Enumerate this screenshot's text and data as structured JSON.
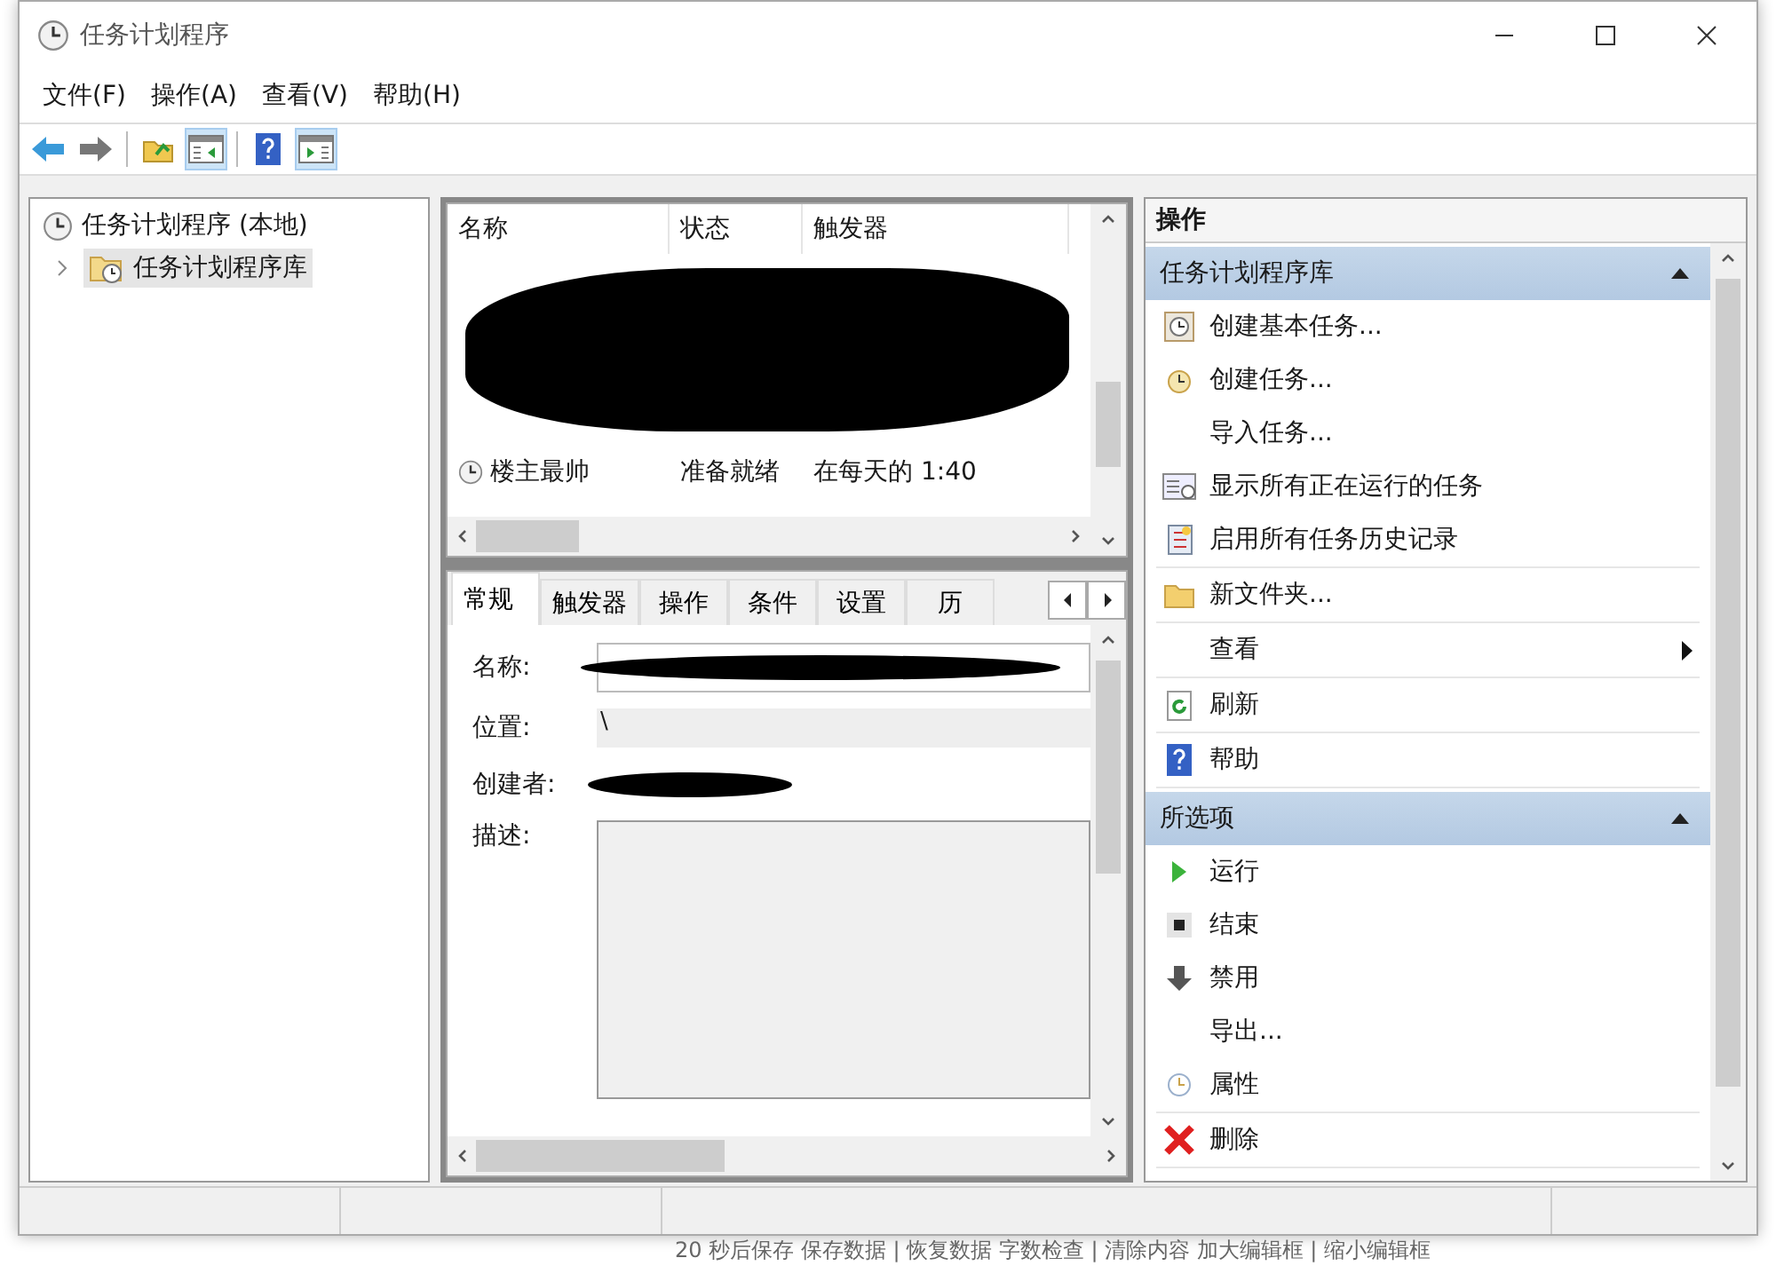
{
  "window": {
    "title": "任务计划程序"
  },
  "menu": [
    "文件(F)",
    "操作(A)",
    "查看(V)",
    "帮助(H)"
  ],
  "toolbar": [
    [
      {
        "kind": "back",
        "on": false
      },
      {
        "kind": "forward",
        "on": false
      }
    ],
    [
      {
        "kind": "folder-up",
        "on": false
      },
      {
        "kind": "tree-pane",
        "on": true
      }
    ],
    [
      {
        "kind": "help",
        "on": false
      },
      {
        "kind": "action-pane",
        "on": true
      }
    ]
  ],
  "tree": [
    {
      "label": "任务计划程序 (本地)",
      "selected": false,
      "children": [
        {
          "label": "任务计划程序库",
          "selected": true
        }
      ]
    }
  ],
  "task_list": {
    "columns": [
      "名称",
      "状态",
      "触发器"
    ],
    "rows": [
      {
        "name": "楼主最帅",
        "status": "准备就绪",
        "trigger": "在每天的 1:40"
      }
    ]
  },
  "detail_tabs": [
    {
      "label": "常规",
      "selected": true
    },
    {
      "label": "触发器",
      "selected": false
    },
    {
      "label": "操作",
      "selected": false
    },
    {
      "label": "条件",
      "selected": false
    },
    {
      "label": "设置",
      "selected": false
    },
    {
      "label": "历",
      "selected": false
    }
  ],
  "general_fields": [
    {
      "label": "名称:",
      "kind": "redacted-field"
    },
    {
      "label": "位置:",
      "kind": "readonly",
      "value": "\\"
    },
    {
      "label": "创建者:",
      "kind": "redacted"
    },
    {
      "label": "描述:",
      "kind": "textarea"
    }
  ],
  "actions": {
    "title": "操作",
    "sections": [
      {
        "title": "任务计划程序库",
        "groups": [
          [
            {
              "label": "创建基本任务...",
              "kind": "basic-task",
              "submenu": false
            },
            {
              "label": "创建任务...",
              "kind": "task",
              "submenu": false
            },
            {
              "label": "导入任务...",
              "kind": "none",
              "submenu": false
            },
            {
              "label": "显示所有正在运行的任务",
              "kind": "running",
              "submenu": false
            },
            {
              "label": "启用所有任务历史记录",
              "kind": "history",
              "submenu": false
            }
          ],
          [
            {
              "label": "新文件夹...",
              "kind": "folder",
              "submenu": false
            }
          ],
          [
            {
              "label": "查看",
              "kind": "none",
              "submenu": true
            }
          ],
          [
            {
              "label": "刷新",
              "kind": "refresh",
              "submenu": false
            }
          ],
          [
            {
              "label": "帮助",
              "kind": "help",
              "submenu": false
            }
          ]
        ]
      },
      {
        "title": "所选项",
        "groups": [
          [
            {
              "label": "运行",
              "kind": "run",
              "submenu": false
            },
            {
              "label": "结束",
              "kind": "stop",
              "submenu": false
            },
            {
              "label": "禁用",
              "kind": "disable",
              "submenu": false
            },
            {
              "label": "导出...",
              "kind": "none",
              "submenu": false
            },
            {
              "label": "属性",
              "kind": "properties",
              "submenu": false
            }
          ],
          [
            {
              "label": "删除",
              "kind": "delete",
              "submenu": false
            }
          ]
        ]
      }
    ]
  },
  "background_page": {
    "text": "20 秒后保存 保存数据 | 恢复数据 字数检查 | 清除内容 加大编辑框 | 缩小编辑框"
  }
}
